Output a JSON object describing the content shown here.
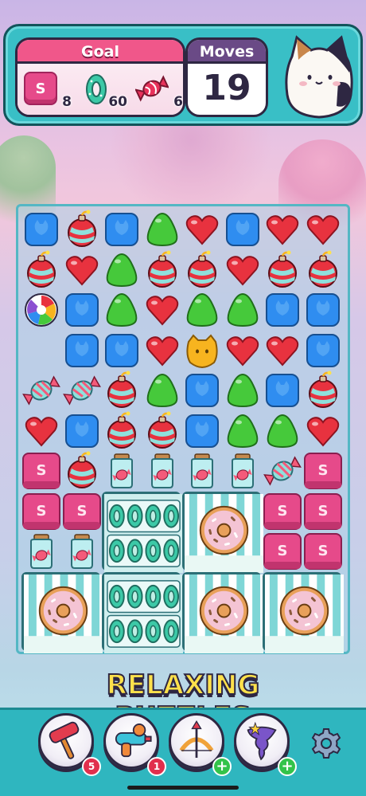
{
  "hud": {
    "goal_title": "Goal",
    "goals": [
      {
        "icon": "s-tile-icon",
        "tile_letter": "S",
        "count": "8"
      },
      {
        "icon": "donut-icon",
        "count": "60"
      },
      {
        "icon": "candy-icon",
        "count": "6"
      }
    ],
    "moves_title": "Moves",
    "moves_value": "19"
  },
  "banner": "RELAXING PUZZLES",
  "board_tile_letter": "S",
  "boosters": [
    {
      "name": "hammer-booster",
      "icon": "hammer-icon",
      "badge": "5",
      "badge_color": "#e12f4d"
    },
    {
      "name": "water-gun-booster",
      "icon": "water-gun-icon",
      "badge": "1",
      "badge_color": "#e12f4d"
    },
    {
      "name": "bow-arrow-booster",
      "icon": "bow-arrow-icon",
      "badge": "+",
      "badge_color": "#33c34a"
    },
    {
      "name": "tornado-booster",
      "icon": "tornado-icon",
      "badge": "+",
      "badge_color": "#33c34a"
    }
  ],
  "board": {
    "rows": [
      [
        "blue",
        "bomb",
        "blue",
        "green",
        "heart",
        "blue",
        "heart",
        "heart"
      ],
      [
        "bomb",
        "heart",
        "green",
        "bomb",
        "bomb",
        "heart",
        "bomb",
        "bomb"
      ],
      [
        "rainbow",
        "blue",
        "green",
        "heart",
        "green",
        "green",
        "blue",
        "blue"
      ],
      [
        "empty",
        "blue",
        "blue",
        "heart",
        "yellow",
        "heart",
        "heart",
        "blue"
      ],
      [
        "candy",
        "candy",
        "bomb",
        "green",
        "blue",
        "green",
        "blue",
        "bomb"
      ],
      [
        "heart",
        "blue",
        "bomb",
        "bomb",
        "blue",
        "green",
        "green",
        "heart"
      ],
      [
        "stile",
        "bomb",
        "jar",
        "jar",
        "jar",
        "jar",
        "candy",
        "stile"
      ],
      [
        "stile",
        "stile",
        "frame",
        "frame",
        "frame",
        "frame",
        "stile",
        "stile"
      ],
      [
        "jar",
        "jar",
        "frame",
        "frame",
        "frame",
        "frame",
        "stile",
        "stile"
      ],
      [
        "frame",
        "frame",
        "frame",
        "frame",
        "frame",
        "frame",
        "frame",
        "frame"
      ],
      [
        "frame",
        "frame",
        "frame",
        "frame",
        "frame",
        "frame",
        "frame",
        "frame"
      ]
    ],
    "frames": [
      {
        "type": "donut-rings",
        "col": 2,
        "row": 7,
        "w": 2,
        "h": 2
      },
      {
        "type": "big-donut",
        "col": 4,
        "row": 7,
        "w": 2,
        "h": 2
      },
      {
        "type": "big-donut",
        "col": 0,
        "row": 9,
        "w": 2,
        "h": 2
      },
      {
        "type": "donut-rings",
        "col": 2,
        "row": 9,
        "w": 2,
        "h": 2
      },
      {
        "type": "big-donut",
        "col": 4,
        "row": 9,
        "w": 2,
        "h": 2
      },
      {
        "type": "big-donut",
        "col": 6,
        "row": 9,
        "w": 2,
        "h": 2
      }
    ]
  },
  "colors": {
    "heart": "#e8323f",
    "blue": "#2f8df0",
    "green": "#46c93b",
    "yellow": "#f7b41f",
    "s_tile": "#e64a8a",
    "hud_teal": "#39bfc6"
  }
}
